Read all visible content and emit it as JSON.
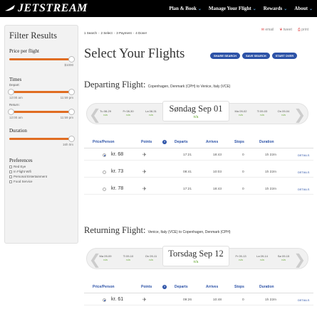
{
  "header": {
    "brand": "JETSTREAM",
    "nav": [
      {
        "label": "Plan & Book"
      },
      {
        "label": "Manage Your Flight"
      },
      {
        "label": "Rewards"
      },
      {
        "label": "About"
      }
    ]
  },
  "sidebar": {
    "title": "Filter Results",
    "price_heading": "Price per flight",
    "price_max": "$1000",
    "times_heading": "Times",
    "depart_label": "Depart:",
    "depart_from": "12:00 am",
    "depart_to": "11:59 pm",
    "return_label": "Return:",
    "return_from": "12:00 am",
    "return_to": "11:59 pm",
    "duration_heading": "Duration",
    "duration_max": "16h 0m",
    "preferences_heading": "Preferences",
    "preferences": [
      "Red Eye",
      "In Flight Wifi",
      "Personal Entertainment",
      "Food Service"
    ]
  },
  "steps": [
    "1 Search",
    "2 Select",
    "3 Payment",
    "4 Done!"
  ],
  "share": {
    "email": "email",
    "tweet": "tweet",
    "print": "print"
  },
  "page_title": "Select Your Flights",
  "actions": [
    "SHARE SEARCH",
    "SAVE SEARCH",
    "START OVER"
  ],
  "departing": {
    "title": "Departing Flight:",
    "route": "Copenhagen, Denmark (CPH) to Venice, Italy (VCE)",
    "dates_before": [
      {
        "day": "Tu 08-29",
        "price": "n/a"
      },
      {
        "day": "Fr 08-30",
        "price": "n/a"
      },
      {
        "day": "La 08-31",
        "price": "n/a"
      }
    ],
    "selected": {
      "day": "Søndag Sep 01",
      "price": "n/a"
    },
    "dates_after": [
      {
        "day": "Ma 09-02",
        "price": "n/a"
      },
      {
        "day": "Ti 09-03",
        "price": "n/a"
      },
      {
        "day": "On 09-04",
        "price": "n/a"
      }
    ],
    "columns": [
      "Price/Person",
      "Points",
      "Departs",
      "Arrives",
      "Stops",
      "Duration"
    ],
    "rows": [
      {
        "price": "kr. 68",
        "departs": "17:21",
        "arrives": "18:43",
        "stops": "0",
        "duration": "1h 22m",
        "details": "DETAILS",
        "selected": true
      },
      {
        "price": "kr. 73",
        "departs": "08:41",
        "arrives": "10:03",
        "stops": "0",
        "duration": "1h 22m",
        "details": "DETAILS",
        "selected": false
      },
      {
        "price": "kr. 78",
        "departs": "17:21",
        "arrives": "18:43",
        "stops": "0",
        "duration": "1h 22m",
        "details": "DETAILS",
        "selected": false
      }
    ]
  },
  "returning": {
    "title": "Returning Flight:",
    "route": "Venice, Italy (VCE) to Copenhagen, Denmark (CPH)",
    "dates_before": [
      {
        "day": "Ma 09-09",
        "price": "n/a"
      },
      {
        "day": "Ti 09-10",
        "price": "n/a"
      },
      {
        "day": "On 09-11",
        "price": "n/a"
      }
    ],
    "selected": {
      "day": "Torsdag Sep 12",
      "price": "n/a"
    },
    "dates_after": [
      {
        "day": "Fr 09-13",
        "price": "n/a"
      },
      {
        "day": "La 09-14",
        "price": "n/a"
      },
      {
        "day": "Sø 09-15",
        "price": "n/a"
      }
    ],
    "columns": [
      "Price/Person",
      "Points",
      "Departs",
      "Arrives",
      "Stops",
      "Duration"
    ],
    "rows": [
      {
        "price": "kr. 61",
        "departs": "09:26",
        "arrives": "10:48",
        "stops": "0",
        "duration": "1h 22m",
        "details": "DETAILS",
        "selected": true
      }
    ]
  },
  "colors": {
    "accent": "#2c52a7",
    "slider": "#e06d22",
    "na": "#6aaa3a",
    "topbar": "#000000"
  }
}
